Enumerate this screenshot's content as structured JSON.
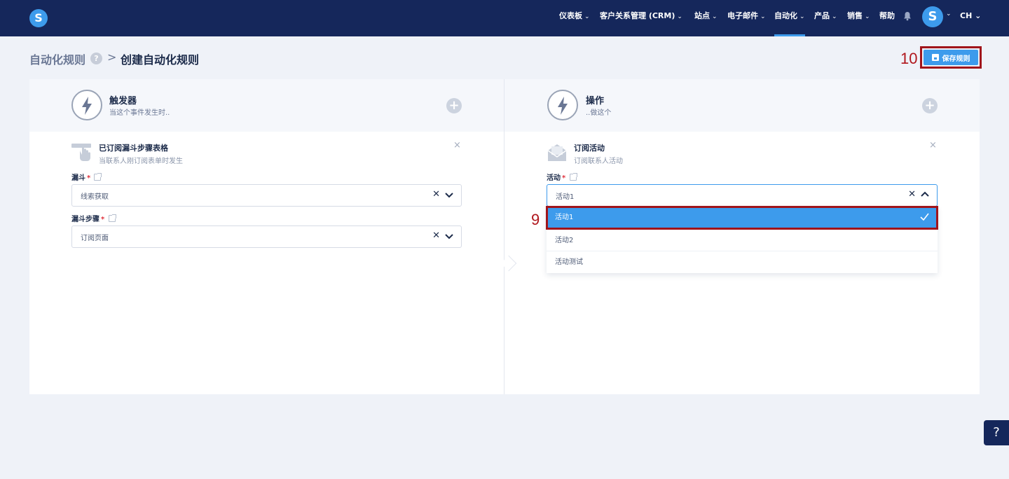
{
  "nav": {
    "items": [
      {
        "label": "仪表板",
        "chevron": "⌄"
      },
      {
        "label": "客户关系管理 (CRM)",
        "chevron": "⌄"
      },
      {
        "label": "站点",
        "chevron": "⌄"
      },
      {
        "label": "电子邮件",
        "chevron": "⌄"
      },
      {
        "label": "自动化",
        "chevron": "⌄",
        "active": true
      },
      {
        "label": "产品",
        "chevron": "⌄"
      },
      {
        "label": "销售",
        "chevron": "⌄"
      },
      {
        "label": "帮助",
        "chevron": ""
      }
    ],
    "logo_letter": "S",
    "avatar_letter": "S",
    "language": "CH ⌄"
  },
  "breadcrumb": {
    "root": "自动化规则",
    "help": "?",
    "separator": ">",
    "current": "创建自动化规则"
  },
  "annotations": {
    "save": "10",
    "option": "9"
  },
  "save_button": {
    "label": "保存规则"
  },
  "trigger": {
    "title": "触发器",
    "subtitle": "当这个事件发生时..",
    "item_title": "已订阅漏斗步骤表格",
    "item_sub": "当联系人刚订阅表单时发生",
    "close": "×",
    "funnel_label": "漏斗",
    "funnel_value": "线索获取",
    "step_label": "漏斗步骤",
    "step_value": "订阅页面",
    "required_mark": "*"
  },
  "action": {
    "title": "操作",
    "subtitle": "..做这个",
    "item_title": "订阅活动",
    "item_sub": "订阅联系人活动",
    "close": "×",
    "campaign_label": "活动",
    "campaign_value": "活动1",
    "required_mark": "*",
    "options": [
      "活动1",
      "活动2",
      "活动测试"
    ]
  },
  "help_button": "?",
  "colors": {
    "nav_bg": "#15275b",
    "accent": "#3d9bec",
    "annotation": "#a0141b"
  }
}
